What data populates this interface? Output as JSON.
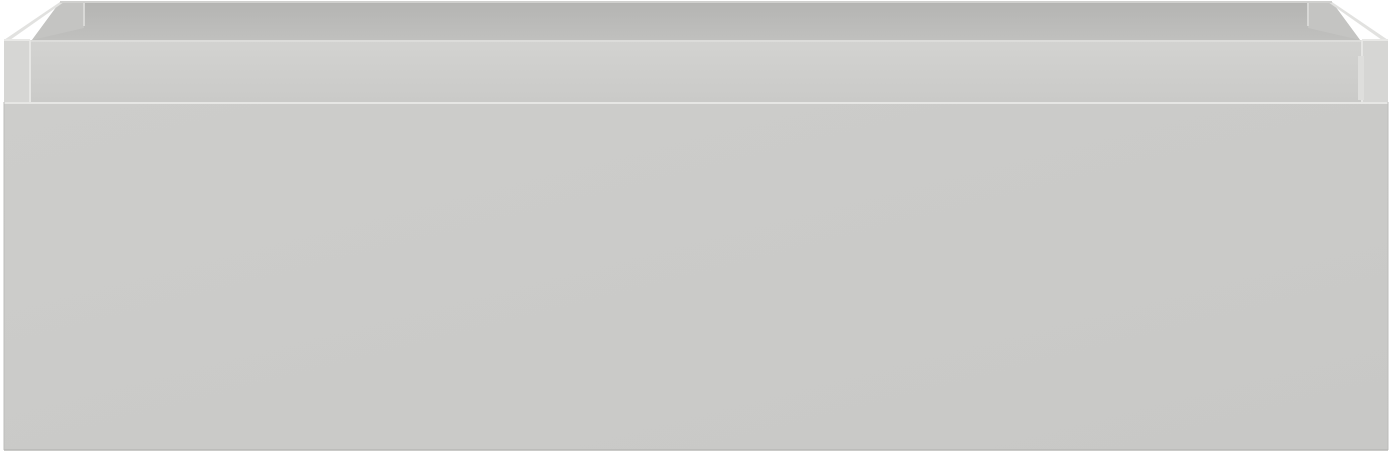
{
  "scene": {
    "subject": "drawer-box-render",
    "palette": {
      "front": "#cbcbc9",
      "front_edge": "#bdbdbb",
      "inner_back": "#b9b9b7",
      "inner_top_shadow": "#aeaeac",
      "rim": "#e4e4e2",
      "side_wall": "#d7d7d5",
      "inner_side": "#c2c2c0",
      "outline": "#a8a8a6",
      "background": "#ffffff"
    }
  }
}
